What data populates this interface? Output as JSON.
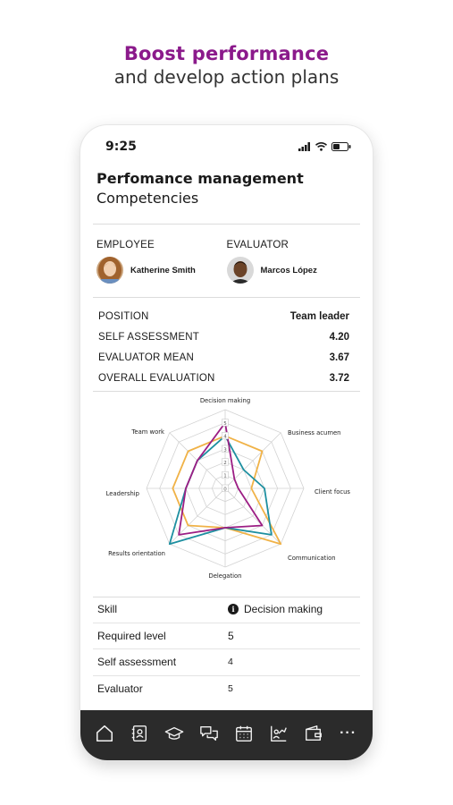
{
  "promo": {
    "title": "Boost performance",
    "subtitle": "and develop action plans"
  },
  "status_bar": {
    "time": "9:25"
  },
  "header": {
    "title": "Perfomance management",
    "subtitle": "Competencies"
  },
  "people": {
    "employee": {
      "label": "EMPLOYEE",
      "name": "Katherine Smith"
    },
    "evaluator": {
      "label": "EVALUATOR",
      "name": "Marcos López"
    }
  },
  "metrics": [
    {
      "label": "POSITION",
      "value": "Team leader"
    },
    {
      "label": "SELF ASSESSMENT",
      "value": "4.20"
    },
    {
      "label": "EVALUATOR MEAN",
      "value": "3.67"
    },
    {
      "label": "OVERALL EVALUATION",
      "value": "3.72"
    }
  ],
  "chart_data": {
    "type": "radar",
    "axes": [
      "Decision making",
      "Business acumen",
      "Client focus",
      "Communication",
      "Delegation",
      "Results orientation",
      "Leadership",
      "Team work"
    ],
    "scale_labels": [
      "0",
      "1",
      "2",
      "3",
      "4",
      "5"
    ],
    "rmax": 6,
    "series": [
      {
        "color": "#f0b247",
        "values": [
          4,
          4,
          2,
          6,
          3,
          4,
          4,
          4
        ]
      },
      {
        "color": "#1d8fa0",
        "values": [
          4,
          2,
          3,
          5,
          3,
          6,
          3,
          3
        ]
      },
      {
        "color": "#9c1e84",
        "values": [
          5,
          1,
          1,
          4,
          3,
          5,
          3,
          3
        ]
      }
    ]
  },
  "skills": [
    {
      "key": "Skill",
      "value": "Decision making",
      "info": true
    },
    {
      "key": "Required level",
      "value": "5"
    },
    {
      "key": "Self assessment",
      "value": "4"
    },
    {
      "key": "Evaluator",
      "value": "5"
    }
  ],
  "tabbar": {
    "icons": [
      "home-icon",
      "contacts-icon",
      "graduation-cap-icon",
      "chat-icon",
      "calendar-icon",
      "growth-icon",
      "wallet-icon",
      "more-icon"
    ],
    "more_label": "···",
    "color": "#f0f0f0",
    "background": "#2b2b2b"
  }
}
